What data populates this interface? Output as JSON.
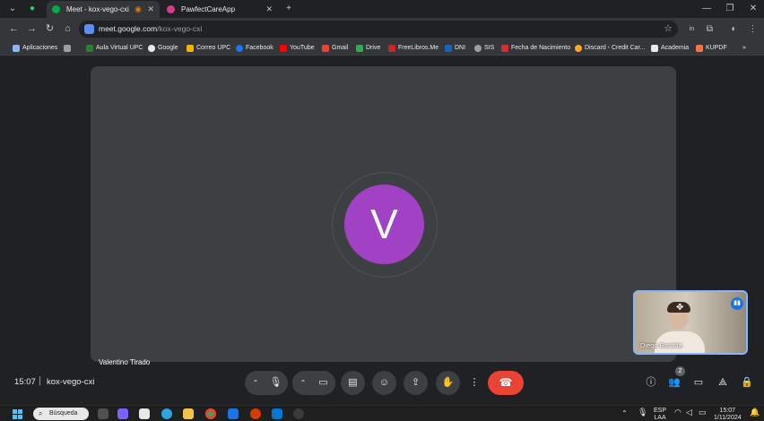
{
  "browser": {
    "tabs": [
      {
        "label": "Meet - kox-vego-cxi",
        "active": true
      },
      {
        "label": "PawfectCareApp",
        "active": false
      }
    ],
    "address": {
      "domain": "meet.google.com",
      "path": "/kox-vego-cxi"
    },
    "bookmarks": [
      "Aplicaciones",
      "Aula Virtual UPC",
      "Google",
      "Correo UPC",
      "Facebook",
      "YouTube",
      "Gmail",
      "Drive",
      "FreeLibros.Me",
      "DNI",
      "SIS",
      "Fecha de Nacimiento",
      "Discard - Credit Car...",
      "Academia",
      "KUPDF"
    ]
  },
  "meeting": {
    "main_participant": {
      "initial": "V",
      "name": "Valentino Tirado",
      "avatar_color": "#a142c4"
    },
    "self_view": {
      "name": "Diego Bastida"
    },
    "time": "15:07",
    "separator": "|",
    "code": "kox-vego-cxi",
    "people_count": "2"
  },
  "taskbar": {
    "search_label": "Búsqueda",
    "lang_top": "ESP",
    "lang_bottom": "LAA",
    "clock_time": "15:07",
    "clock_date": "1/11/2024"
  },
  "colors": {
    "accent": "#8ab4f8",
    "end_call": "#ea4335"
  }
}
